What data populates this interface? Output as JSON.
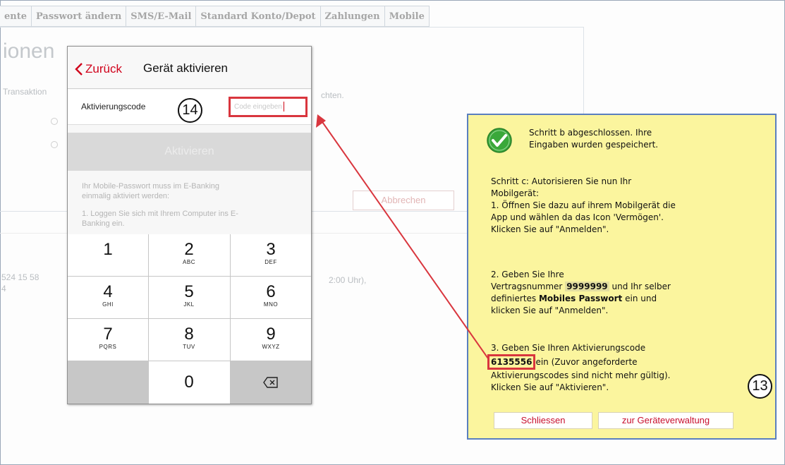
{
  "tabs": [
    "ente",
    "Passwort ändern",
    "SMS/E-Mail",
    "Standard Konto/Depot",
    "Zahlungen",
    "Mobile"
  ],
  "background": {
    "heading": "ionen",
    "transaktion_text": "Transaktion",
    "right_text": "chten.",
    "cancel_button": "Abbrechen",
    "date_left": "524 15 58",
    "date_left2": "4",
    "time_text": "2:00 Uhr),"
  },
  "phone": {
    "back_label": "Zurück",
    "title": "Gerät aktivieren",
    "code_label": "Aktivierungscode",
    "code_placeholder": "Code eingeben",
    "activate_button": "Aktivieren",
    "info_line1": "Ihr Mobile-Passwort muss im E-Banking",
    "info_line2": "einmalig aktiviert werden:",
    "info_line3": "1. Loggen Sie sich mit Ihrem Computer ins E-",
    "info_line4": "Banking ein.",
    "keys": [
      {
        "digit": "1",
        "letters": ""
      },
      {
        "digit": "2",
        "letters": "ABC"
      },
      {
        "digit": "3",
        "letters": "DEF"
      },
      {
        "digit": "4",
        "letters": "GHI"
      },
      {
        "digit": "5",
        "letters": "JKL"
      },
      {
        "digit": "6",
        "letters": "MNO"
      },
      {
        "digit": "7",
        "letters": "PQRS"
      },
      {
        "digit": "8",
        "letters": "TUV"
      },
      {
        "digit": "9",
        "letters": "WXYZ"
      }
    ],
    "zero_key": "0",
    "delete_icon": "backspace-icon"
  },
  "annotations": {
    "step14": "14",
    "step13": "13"
  },
  "popup": {
    "head_line1": "Schritt b abgeschlossen. Ihre",
    "head_line2": "Eingaben wurden gespeichert.",
    "c_line1": "Schritt c: Autorisieren Sie nun Ihr",
    "c_line2": "Mobilgerät:",
    "c_line3": "1. Öffnen Sie dazu auf ihrem Mobilgerät die",
    "c_line4": "App und wählen da das Icon 'Vermögen'.",
    "c_line5": "Klicken Sie auf \"Anmelden\".",
    "s2_line1": "2. Geben Sie Ihre",
    "s2_line2a": "Vertragsnummer",
    "contract_number": "9999999",
    "s2_line2b": "und Ihr selber",
    "s2_line3a": "definiertes",
    "s2_line3b": "Mobiles Passwort",
    "s2_line3c": "ein und",
    "s2_line4": "klicken Sie auf \"Anmelden\".",
    "s3_line1": "3. Geben Sie Ihren Aktivierungscode",
    "activation_code": "6135556",
    "s3_line2b": "ein (Zuvor angeforderte",
    "s3_line3": "Aktivierungscodes sind nicht mehr gültig).",
    "s3_line4": "Klicken Sie auf \"Aktivieren\".",
    "close_button": "Schliessen",
    "devices_button": "zur Geräteverwaltung"
  },
  "colors": {
    "accent_red": "#d0021b",
    "popup_yellow": "#fbf59e",
    "popup_border": "#5a7fbf",
    "check_green": "#3aa83a"
  }
}
